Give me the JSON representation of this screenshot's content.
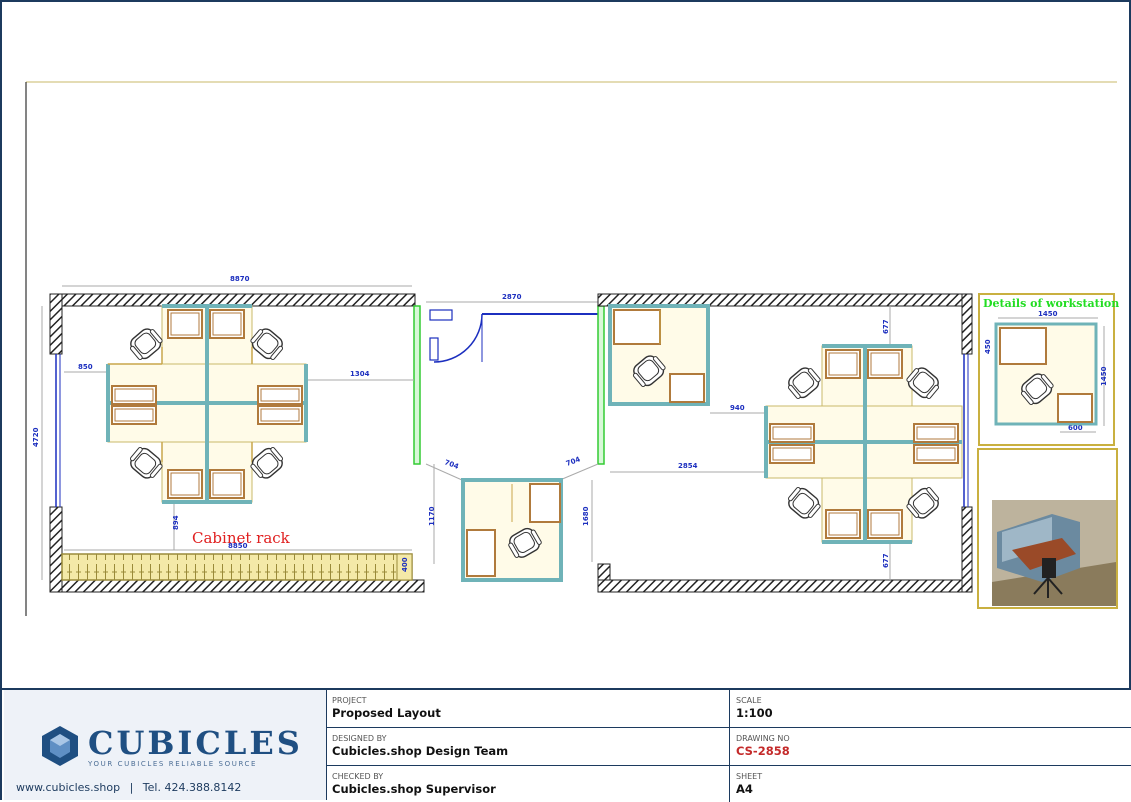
{
  "drawing": {
    "cabinet_label": "Cabinet rack",
    "detail_title": "Details of workstation",
    "dims": {
      "top_left": "8870",
      "left_height": "4720",
      "left_small": "850",
      "left_gap": "1304",
      "left_cab": "894",
      "cab_len": "8850",
      "cab_end": "400",
      "corridor_top": "2870",
      "corridor_left": "1170",
      "door_a": "704",
      "door_b": "704",
      "corridor_right": "1680",
      "right_top": "677",
      "right_mid": "940",
      "right_span": "2854",
      "right_bottom": "677",
      "detail_w": "1450",
      "detail_h": "1450",
      "detail_s": "450",
      "detail_b": "600"
    }
  },
  "titleblock": {
    "brand": "CUBICLES",
    "tagline": "YOUR CUBICLES RELIABLE SOURCE",
    "website": "www.cubicles.shop",
    "separator": "|",
    "phone": "Tel. 424.388.8142",
    "project_label": "PROJECT",
    "project_value": "Proposed Layout",
    "designed_label": "DESIGNED BY",
    "designed_value": "Cubicles.shop Design Team",
    "checked_label": "CHECKED BY",
    "checked_value": "Cubicles.shop Supervisor",
    "scale_label": "SCALE",
    "scale_value": "1:100",
    "drawing_no_label": "DRAWING NO",
    "drawing_no_value": "CS-2858",
    "sheet_label": "SHEET",
    "sheet_value": "A4"
  },
  "colors": {
    "frame": "#1c3a5e",
    "wall_hatch": "#2a2a2a",
    "partition": "#6fb3b8",
    "desk": "#b58a52",
    "green_wall": "#33cc33",
    "dimension": "#1c2fbf",
    "cabinet_text": "#e02020",
    "detail_text": "#22dd22"
  }
}
